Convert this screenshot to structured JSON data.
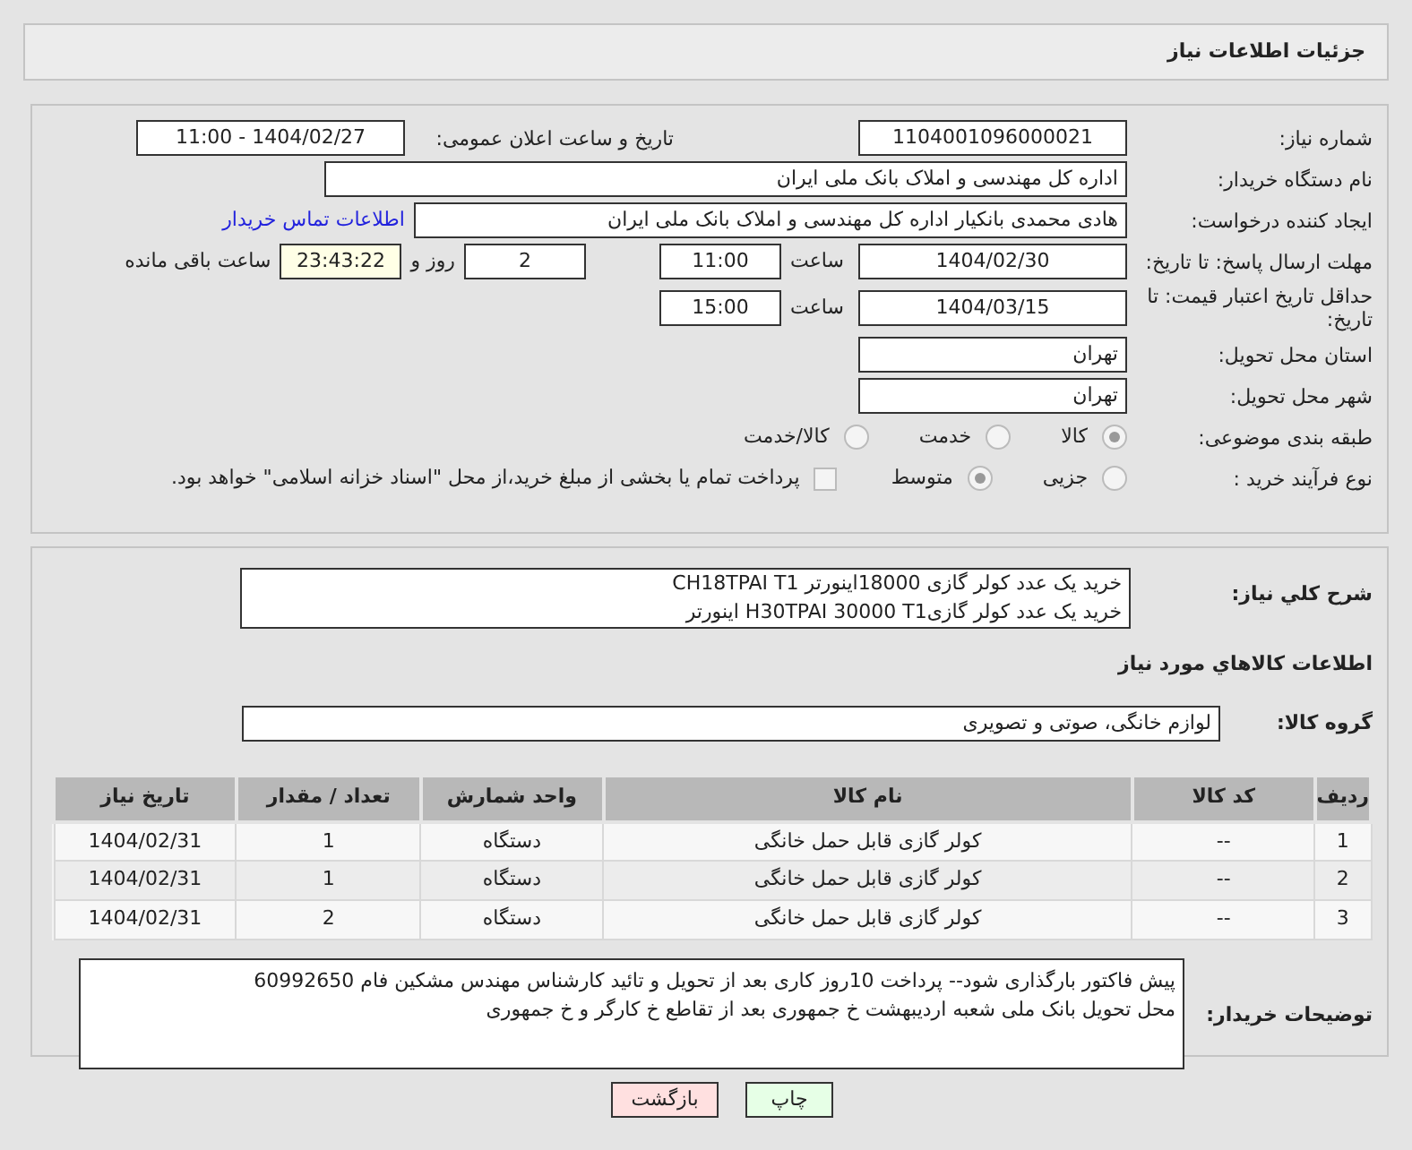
{
  "header": {
    "title": "جزئیات اطلاعات نیاز"
  },
  "form": {
    "need_number": {
      "label": "شماره نیاز:",
      "value": "1104001096000021"
    },
    "announce": {
      "label": "تاریخ و ساعت اعلان عمومی:",
      "value": "1404/02/27 - 11:00"
    },
    "buyer_org": {
      "label": "نام دستگاه خریدار:",
      "value": "اداره کل مهندسی و املاک بانک ملی ایران"
    },
    "creator": {
      "label": "ایجاد کننده درخواست:",
      "value": "هادی محمدی بانکیار اداره کل مهندسی و املاک بانک ملی ایران",
      "link": "اطلاعات تماس خریدار"
    },
    "deadline": {
      "label": "مهلت ارسال پاسخ: تا تاریخ:",
      "date": "1404/02/30",
      "time_label": "ساعت",
      "time": "11:00",
      "days": "2",
      "days_label": "روز و",
      "remaining": "23:43:22",
      "remaining_label": "ساعت باقی مانده"
    },
    "validity": {
      "label": "حداقل تاریخ اعتبار قیمت: تا تاریخ:",
      "date": "1404/03/15",
      "time_label": "ساعت",
      "time": "15:00"
    },
    "province": {
      "label": "استان محل تحویل:",
      "value": "تهران"
    },
    "city": {
      "label": "شهر محل تحویل:",
      "value": "تهران"
    },
    "category": {
      "label": "طبقه بندی موضوعی:",
      "options": [
        {
          "label": "کالا",
          "selected": true
        },
        {
          "label": "خدمت",
          "selected": false
        },
        {
          "label": "کالا/خدمت",
          "selected": false
        }
      ]
    },
    "process": {
      "label": "نوع فرآیند خرید :",
      "options": [
        {
          "label": "جزیی",
          "selected": false
        },
        {
          "label": "متوسط",
          "selected": true
        }
      ],
      "payment": {
        "label": "پرداخت تمام یا بخشی از مبلغ خرید،از محل \"اسناد خزانه اسلامی\" خواهد بود.",
        "checked": false
      }
    }
  },
  "details": {
    "description": {
      "label": "شرح کلي نياز:",
      "lines": [
        "خرید یک عدد کولر گازی 18000اینورتر CH18TPAI  T1",
        "خرید یک عدد کولر گازیH30TPAI 30000 T1 اینورتر"
      ]
    },
    "items_title": "اطلاعات کالاهاي مورد نياز",
    "group": {
      "label": "گروه کالا:",
      "value": "لوازم خانگی، صوتی و تصویری"
    },
    "table": {
      "columns": [
        "ردیف",
        "کد کالا",
        "نام کالا",
        "واحد شمارش",
        "تعداد / مقدار",
        "تاریخ نیاز"
      ],
      "rows": [
        [
          "1",
          "--",
          "کولر گازی قابل حمل خانگی",
          "دستگاه",
          "1",
          "1404/02/31"
        ],
        [
          "2",
          "--",
          "کولر گازی قابل حمل خانگی",
          "دستگاه",
          "1",
          "1404/02/31"
        ],
        [
          "3",
          "--",
          "کولر گازی قابل حمل خانگی",
          "دستگاه",
          "2",
          "1404/02/31"
        ]
      ]
    },
    "notes": {
      "label": "توضیحات خریدار:",
      "lines": [
        "پیش فاکتور بارگذاری شود-- پرداخت 10روز کاری بعد از تحویل و تائید کارشناس مهندس مشکین فام 60992650",
        "محل تحویل بانک ملی  شعبه اردیبهشت خ جمهوری بعد از تقاطع خ کارگر و خ  جمهوری"
      ]
    }
  },
  "buttons": [
    {
      "label": "چاپ",
      "kind": "print"
    },
    {
      "label": "بازگشت",
      "kind": "back"
    }
  ]
}
